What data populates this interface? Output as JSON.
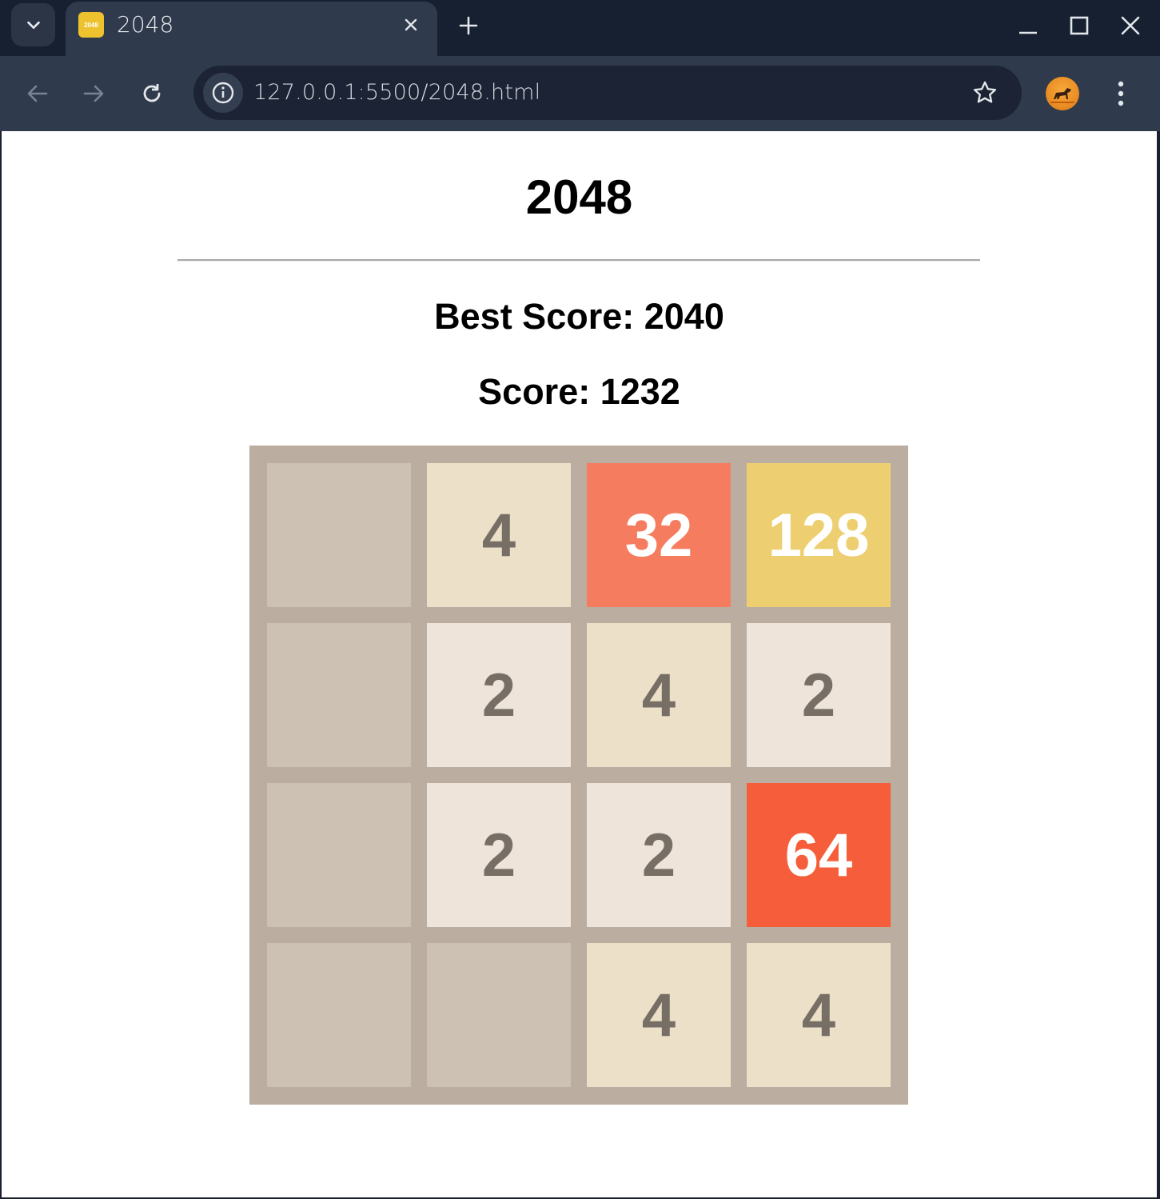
{
  "browser": {
    "tab_title": "2048",
    "tab_favicon_text": "2048",
    "url": "127.0.0.1:5500/2048.html"
  },
  "page": {
    "title": "2048",
    "best_score_label": "Best Score: 2040",
    "score_label": "Score: 1232"
  },
  "board": {
    "rows": [
      [
        "",
        "4",
        "32",
        "128"
      ],
      [
        "",
        "2",
        "4",
        "2"
      ],
      [
        "",
        "2",
        "2",
        "64"
      ],
      [
        "",
        "",
        "4",
        "4"
      ]
    ]
  },
  "tile_colors": {
    "empty": {
      "bg": "#cdc1b4",
      "fg": "#776e65"
    },
    "2": {
      "bg": "#eee4da",
      "fg": "#776e65"
    },
    "4": {
      "bg": "#ede0c8",
      "fg": "#776e65"
    },
    "32": {
      "bg": "#f67c5f",
      "fg": "#ffffff"
    },
    "64": {
      "bg": "#f65e3b",
      "fg": "#ffffff"
    },
    "128": {
      "bg": "#edcf72",
      "fg": "#ffffff"
    }
  },
  "colors": {
    "board_bg": "#bbada0",
    "chrome_dark": "#172030",
    "chrome_toolbar": "#2f3a4c"
  }
}
